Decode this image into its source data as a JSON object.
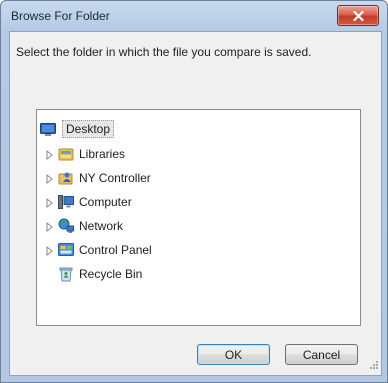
{
  "window": {
    "title": "Browse For Folder",
    "close_icon": "close-x-icon"
  },
  "instruction": "Select the folder in which the file you compare is saved.",
  "tree": {
    "items": [
      {
        "label": "Desktop",
        "icon": "desktop-icon",
        "expandable": false,
        "selected": true
      },
      {
        "label": "Libraries",
        "icon": "libraries-icon",
        "expandable": true,
        "selected": false
      },
      {
        "label": "NY Controller",
        "icon": "user-folder-icon",
        "expandable": true,
        "selected": false
      },
      {
        "label": "Computer",
        "icon": "computer-icon",
        "expandable": true,
        "selected": false
      },
      {
        "label": "Network",
        "icon": "network-icon",
        "expandable": true,
        "selected": false
      },
      {
        "label": "Control Panel",
        "icon": "control-panel-icon",
        "expandable": true,
        "selected": false
      },
      {
        "label": "Recycle Bin",
        "icon": "recycle-bin-icon",
        "expandable": false,
        "selected": false
      }
    ]
  },
  "buttons": {
    "ok": "OK",
    "cancel": "Cancel"
  },
  "colors": {
    "close_button": "#d95a48",
    "selection": "#e6e6e6",
    "default_button_border": "#3c7fb1"
  }
}
